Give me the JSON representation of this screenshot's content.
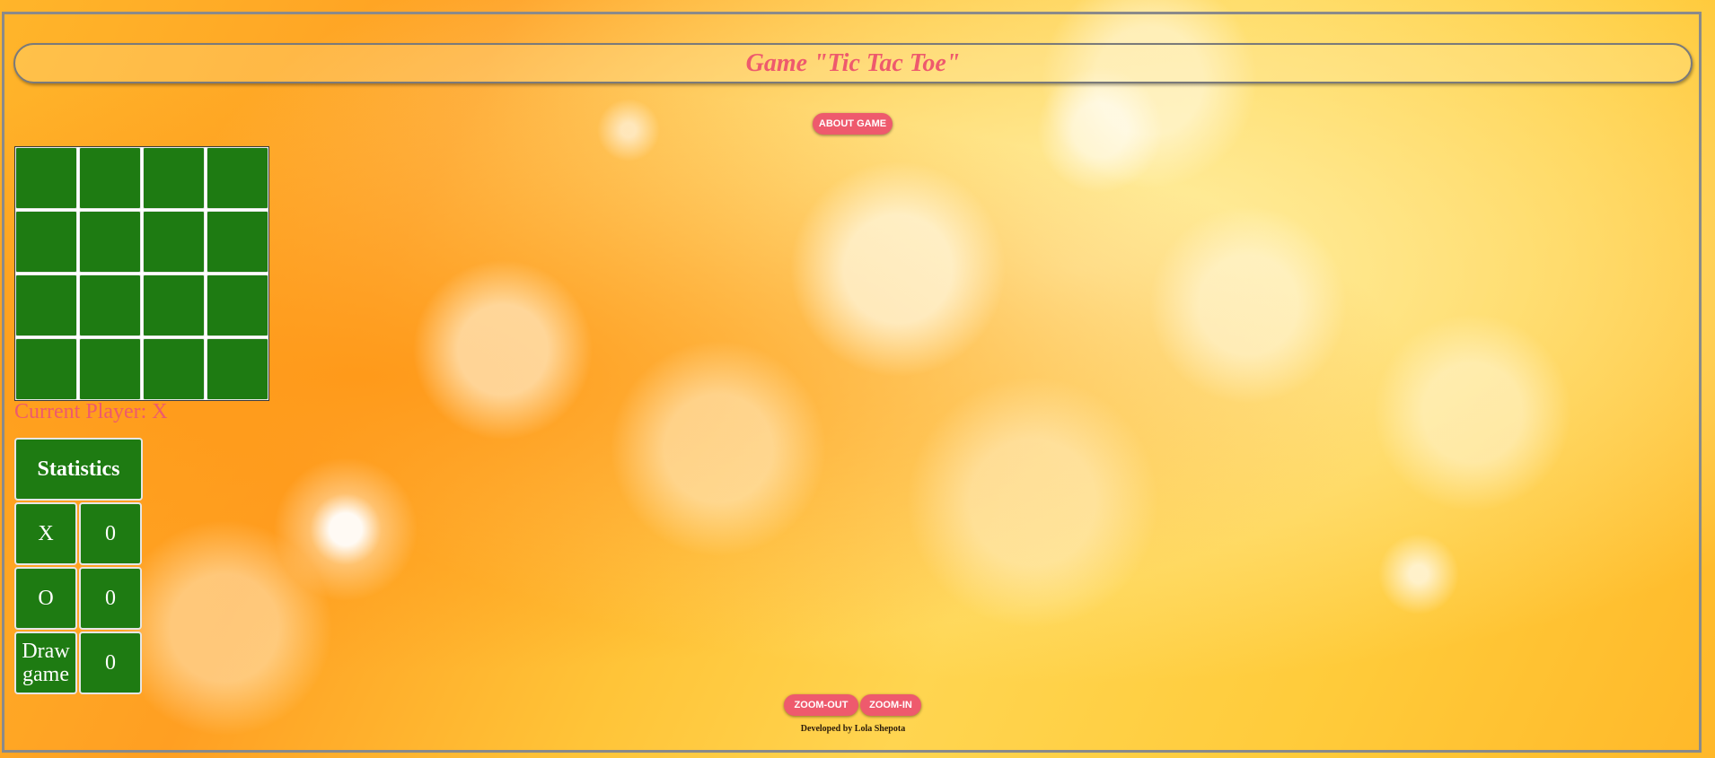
{
  "header": {
    "title": "Game \"Tic Tac Toe\""
  },
  "buttons": {
    "about": "ABOUT GAME",
    "zoom_out": "ZOOM-OUT",
    "zoom_in": "ZOOM-IN"
  },
  "board": {
    "rows": 4,
    "cols": 4,
    "cells": [
      "",
      "",
      "",
      "",
      "",
      "",
      "",
      "",
      "",
      "",
      "",
      "",
      "",
      "",
      "",
      ""
    ]
  },
  "status": {
    "current_player": "Current Player: X"
  },
  "statistics": {
    "title": "Statistics",
    "rows": [
      {
        "label": "X",
        "value": "0"
      },
      {
        "label": "O",
        "value": "0"
      },
      {
        "label": "Draw game",
        "value": "0"
      }
    ]
  },
  "footer": {
    "credit": "Developed by Lola Shepota"
  },
  "colors": {
    "accent": "#ee5a6d",
    "cell": "#1e7b12",
    "frame": "#8a8a8a"
  }
}
